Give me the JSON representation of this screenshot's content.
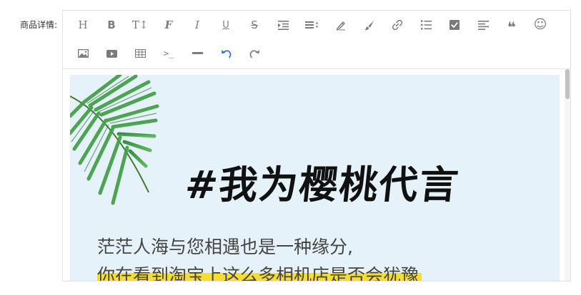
{
  "form": {
    "label": "商品详情:"
  },
  "toolbar": {
    "row1": [
      {
        "name": "heading-button",
        "glyph": "H"
      },
      {
        "name": "bold-button",
        "glyph": "B"
      },
      {
        "name": "font-size-button",
        "glyph": "T↕"
      },
      {
        "name": "font-family-button",
        "glyph": "F"
      },
      {
        "name": "italic-button",
        "glyph": "I"
      },
      {
        "name": "underline-button",
        "glyph": "U"
      },
      {
        "name": "strikethrough-button",
        "glyph": "S"
      },
      {
        "name": "indent-button",
        "glyph": ""
      },
      {
        "name": "line-height-button",
        "glyph": ""
      },
      {
        "name": "font-color-button",
        "glyph": ""
      },
      {
        "name": "background-color-button",
        "glyph": ""
      },
      {
        "name": "link-button",
        "glyph": ""
      },
      {
        "name": "list-button",
        "glyph": ""
      },
      {
        "name": "todo-button",
        "glyph": ""
      },
      {
        "name": "justify-button",
        "glyph": ""
      },
      {
        "name": "quote-button",
        "glyph": "❝"
      },
      {
        "name": "emoticon-button",
        "glyph": "☺"
      }
    ],
    "row2": [
      {
        "name": "image-button",
        "glyph": ""
      },
      {
        "name": "video-button",
        "glyph": ""
      },
      {
        "name": "table-button",
        "glyph": ""
      },
      {
        "name": "code-button",
        "glyph": ">_"
      },
      {
        "name": "divider-button",
        "glyph": ""
      },
      {
        "name": "undo-button",
        "glyph": ""
      },
      {
        "name": "redo-button",
        "glyph": ""
      }
    ],
    "colors": {
      "icon": "#7a7a7a",
      "undo_active": "#1e6fd9"
    }
  },
  "content": {
    "poster": {
      "title": "#我为樱桃代言",
      "line1": "茫茫人海与您相遇也是一种缘分,",
      "line2": "你在看到淘宝上这么多相机店是否会犹豫",
      "background": "#e6f2f9",
      "highlight": "#f4df2f"
    }
  }
}
